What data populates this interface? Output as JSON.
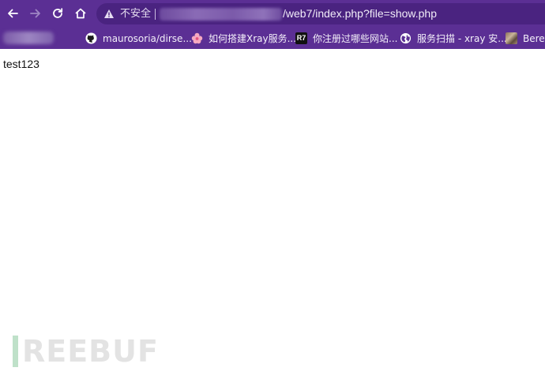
{
  "browser": {
    "security_label": "不安全",
    "url_visible": "/web7/index.php?file=show.php",
    "colors": {
      "toolbar": "#5b2f94",
      "omnibox": "#4a2380"
    }
  },
  "bookmarks": [
    {
      "icon": "github-icon",
      "label": "maurosoria/dirse..."
    },
    {
      "icon": "flower-icon",
      "label": "如何搭建Xray服务..."
    },
    {
      "icon": "r7-icon",
      "icon_text": "R7",
      "label": "你注册过哪些网站..."
    },
    {
      "icon": "globe-icon",
      "label": "服务扫描 - xray 安..."
    },
    {
      "icon": "photo-icon",
      "label": "Beret"
    }
  ],
  "page": {
    "body_text": "test123"
  },
  "watermark": {
    "text": "REEBUF"
  }
}
